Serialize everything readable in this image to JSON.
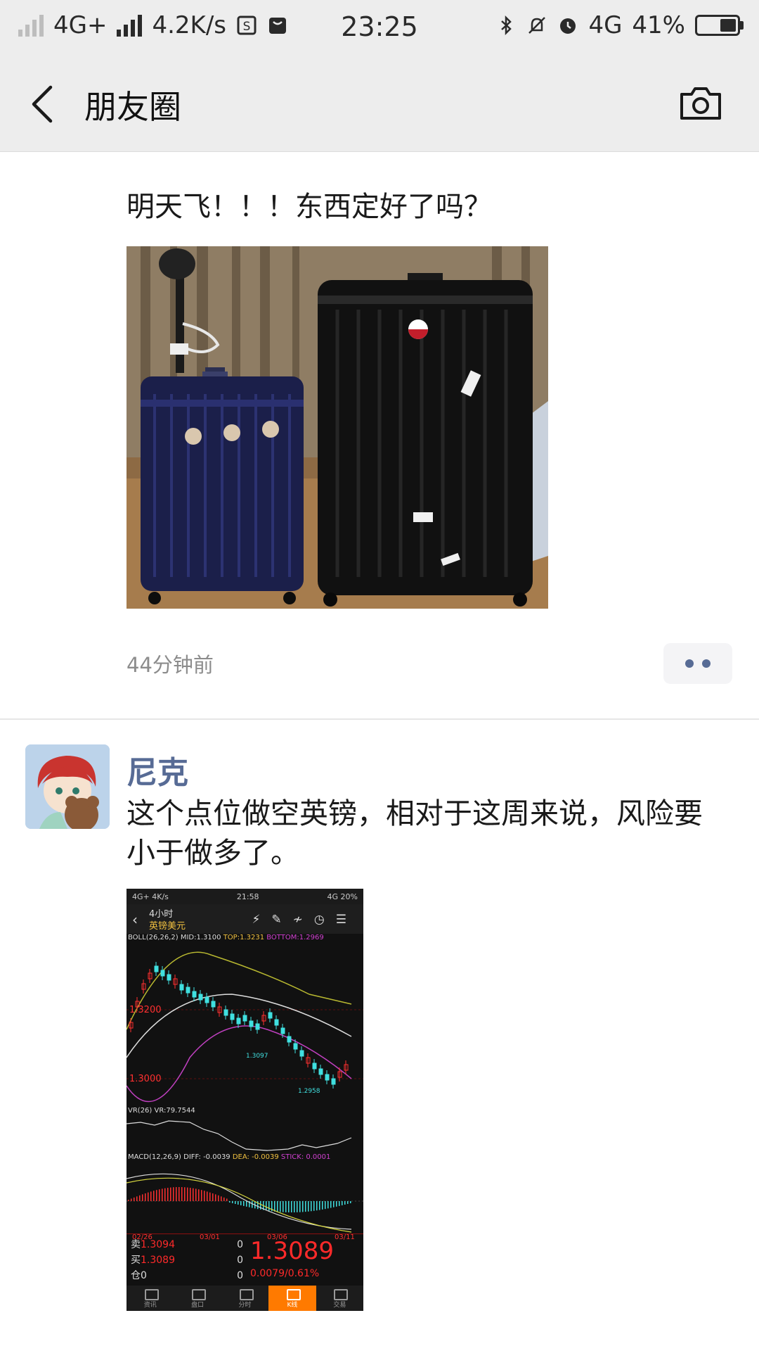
{
  "status_bar": {
    "network_left": "4G+",
    "speed": "4.2K/s",
    "time": "23:25",
    "network_right": "4G",
    "battery": "41%"
  },
  "header": {
    "title": "朋友圈"
  },
  "posts": [
    {
      "text": "明天飞！！！东西定好了吗？",
      "timestamp": "44分钟前"
    },
    {
      "author": "尼克",
      "text": "这个点位做空英镑，相对于这周来说，风险要小于做多了。",
      "screenshot": {
        "status_left": "4G+ 4K/s",
        "status_time": "21:58",
        "status_right": "4G 20%",
        "period": "4小时",
        "pair": "英镑美元",
        "boll_label": "BOLL(26,26,2)",
        "boll_mid": "MID:1.3100",
        "boll_top": "TOP:1.3231",
        "boll_bottom": "BOTTOM:1.2969",
        "price_label_high": "1.3200",
        "price_label_low": "1.3000",
        "price_label_mid": "1.3097",
        "price_label_min": "1.2958",
        "vr_label": "VR(26)",
        "vr_value": "VR:79.7544",
        "macd_label": "MACD(12,26,9)",
        "macd_diff": "DIFF: -0.0039",
        "macd_dea": "DEA: -0.0039",
        "macd_stick": "STICK: 0.0001",
        "dates": [
          "02/26",
          "03/01",
          "03/06",
          "03/11"
        ],
        "sell_label": "卖",
        "sell_price": "1.3094",
        "sell_qty": "0",
        "buy_label": "买",
        "buy_price": "1.3089",
        "buy_qty": "0",
        "pos_label": "仓0",
        "pos_qty": "0",
        "last_price": "1.3089",
        "change": "0.0079/0.61%",
        "tabs": [
          "资讯",
          "盘口",
          "分时",
          "K线",
          "交易"
        ]
      }
    }
  ]
}
